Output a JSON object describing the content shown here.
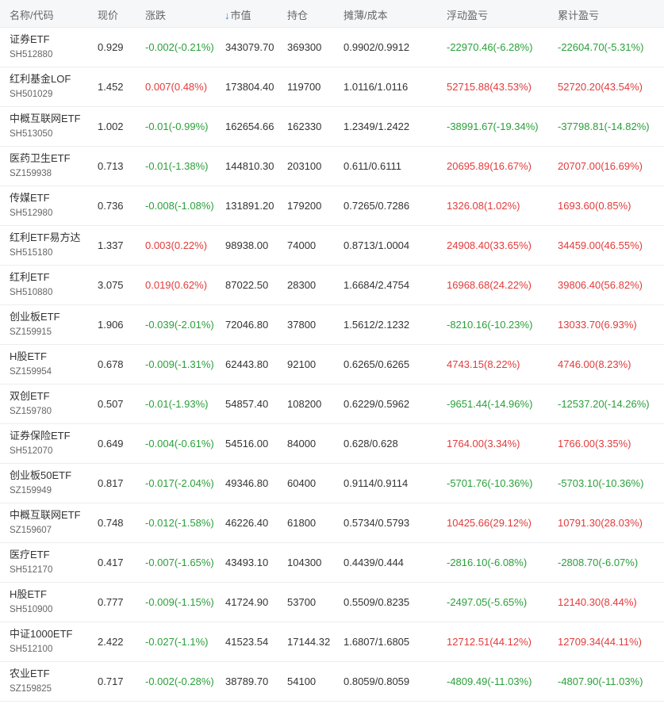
{
  "headers": {
    "name_code": "名称/代码",
    "price": "现价",
    "change": "涨跌",
    "market_value": "市值",
    "holdings": "持仓",
    "cost": "摊薄/成本",
    "floating_pl": "浮动盈亏",
    "total_pl": "累计盈亏",
    "sort_arrow": "↓"
  },
  "colors": {
    "up": "#e23b3b",
    "down": "#2a9f3a",
    "sort_active": "#3b7de0"
  },
  "rows": [
    {
      "name": "证券ETF",
      "code": "SH512880",
      "price": "0.929",
      "change": "-0.002(-0.21%)",
      "change_dir": "down",
      "market_value": "343079.70",
      "holdings": "369300",
      "cost": "0.9902/0.9912",
      "floating_pl": "-22970.46(-6.28%)",
      "floating_dir": "down",
      "total_pl": "-22604.70(-5.31%)",
      "total_dir": "down"
    },
    {
      "name": "红利基金LOF",
      "code": "SH501029",
      "price": "1.452",
      "change": "0.007(0.48%)",
      "change_dir": "up",
      "market_value": "173804.40",
      "holdings": "119700",
      "cost": "1.0116/1.0116",
      "floating_pl": "52715.88(43.53%)",
      "floating_dir": "up",
      "total_pl": "52720.20(43.54%)",
      "total_dir": "up"
    },
    {
      "name": "中概互联网ETF",
      "code": "SH513050",
      "price": "1.002",
      "change": "-0.01(-0.99%)",
      "change_dir": "down",
      "market_value": "162654.66",
      "holdings": "162330",
      "cost": "1.2349/1.2422",
      "floating_pl": "-38991.67(-19.34%)",
      "floating_dir": "down",
      "total_pl": "-37798.81(-14.82%)",
      "total_dir": "down"
    },
    {
      "name": "医药卫生ETF",
      "code": "SZ159938",
      "price": "0.713",
      "change": "-0.01(-1.38%)",
      "change_dir": "down",
      "market_value": "144810.30",
      "holdings": "203100",
      "cost": "0.611/0.6111",
      "floating_pl": "20695.89(16.67%)",
      "floating_dir": "up",
      "total_pl": "20707.00(16.69%)",
      "total_dir": "up"
    },
    {
      "name": "传媒ETF",
      "code": "SH512980",
      "price": "0.736",
      "change": "-0.008(-1.08%)",
      "change_dir": "down",
      "market_value": "131891.20",
      "holdings": "179200",
      "cost": "0.7265/0.7286",
      "floating_pl": "1326.08(1.02%)",
      "floating_dir": "up",
      "total_pl": "1693.60(0.85%)",
      "total_dir": "up"
    },
    {
      "name": "红利ETF易方达",
      "code": "SH515180",
      "price": "1.337",
      "change": "0.003(0.22%)",
      "change_dir": "up",
      "market_value": "98938.00",
      "holdings": "74000",
      "cost": "0.8713/1.0004",
      "floating_pl": "24908.40(33.65%)",
      "floating_dir": "up",
      "total_pl": "34459.00(46.55%)",
      "total_dir": "up"
    },
    {
      "name": "红利ETF",
      "code": "SH510880",
      "price": "3.075",
      "change": "0.019(0.62%)",
      "change_dir": "up",
      "market_value": "87022.50",
      "holdings": "28300",
      "cost": "1.6684/2.4754",
      "floating_pl": "16968.68(24.22%)",
      "floating_dir": "up",
      "total_pl": "39806.40(56.82%)",
      "total_dir": "up"
    },
    {
      "name": "创业板ETF",
      "code": "SZ159915",
      "price": "1.906",
      "change": "-0.039(-2.01%)",
      "change_dir": "down",
      "market_value": "72046.80",
      "holdings": "37800",
      "cost": "1.5612/2.1232",
      "floating_pl": "-8210.16(-10.23%)",
      "floating_dir": "down",
      "total_pl": "13033.70(6.93%)",
      "total_dir": "up"
    },
    {
      "name": "H股ETF",
      "code": "SZ159954",
      "price": "0.678",
      "change": "-0.009(-1.31%)",
      "change_dir": "down",
      "market_value": "62443.80",
      "holdings": "92100",
      "cost": "0.6265/0.6265",
      "floating_pl": "4743.15(8.22%)",
      "floating_dir": "up",
      "total_pl": "4746.00(8.23%)",
      "total_dir": "up"
    },
    {
      "name": "双创ETF",
      "code": "SZ159780",
      "price": "0.507",
      "change": "-0.01(-1.93%)",
      "change_dir": "down",
      "market_value": "54857.40",
      "holdings": "108200",
      "cost": "0.6229/0.5962",
      "floating_pl": "-9651.44(-14.96%)",
      "floating_dir": "down",
      "total_pl": "-12537.20(-14.26%)",
      "total_dir": "down"
    },
    {
      "name": "证券保险ETF",
      "code": "SH512070",
      "price": "0.649",
      "change": "-0.004(-0.61%)",
      "change_dir": "down",
      "market_value": "54516.00",
      "holdings": "84000",
      "cost": "0.628/0.628",
      "floating_pl": "1764.00(3.34%)",
      "floating_dir": "up",
      "total_pl": "1766.00(3.35%)",
      "total_dir": "up"
    },
    {
      "name": "创业板50ETF",
      "code": "SZ159949",
      "price": "0.817",
      "change": "-0.017(-2.04%)",
      "change_dir": "down",
      "market_value": "49346.80",
      "holdings": "60400",
      "cost": "0.9114/0.9114",
      "floating_pl": "-5701.76(-10.36%)",
      "floating_dir": "down",
      "total_pl": "-5703.10(-10.36%)",
      "total_dir": "down"
    },
    {
      "name": "中概互联网ETF",
      "code": "SZ159607",
      "price": "0.748",
      "change": "-0.012(-1.58%)",
      "change_dir": "down",
      "market_value": "46226.40",
      "holdings": "61800",
      "cost": "0.5734/0.5793",
      "floating_pl": "10425.66(29.12%)",
      "floating_dir": "up",
      "total_pl": "10791.30(28.03%)",
      "total_dir": "up"
    },
    {
      "name": "医疗ETF",
      "code": "SH512170",
      "price": "0.417",
      "change": "-0.007(-1.65%)",
      "change_dir": "down",
      "market_value": "43493.10",
      "holdings": "104300",
      "cost": "0.4439/0.444",
      "floating_pl": "-2816.10(-6.08%)",
      "floating_dir": "down",
      "total_pl": "-2808.70(-6.07%)",
      "total_dir": "down"
    },
    {
      "name": "H股ETF",
      "code": "SH510900",
      "price": "0.777",
      "change": "-0.009(-1.15%)",
      "change_dir": "down",
      "market_value": "41724.90",
      "holdings": "53700",
      "cost": "0.5509/0.8235",
      "floating_pl": "-2497.05(-5.65%)",
      "floating_dir": "down",
      "total_pl": "12140.30(8.44%)",
      "total_dir": "up"
    },
    {
      "name": "中证1000ETF",
      "code": "SH512100",
      "price": "2.422",
      "change": "-0.027(-1.1%)",
      "change_dir": "down",
      "market_value": "41523.54",
      "holdings": "17144.32",
      "cost": "1.6807/1.6805",
      "floating_pl": "12712.51(44.12%)",
      "floating_dir": "up",
      "total_pl": "12709.34(44.11%)",
      "total_dir": "up"
    },
    {
      "name": "农业ETF",
      "code": "SZ159825",
      "price": "0.717",
      "change": "-0.002(-0.28%)",
      "change_dir": "down",
      "market_value": "38789.70",
      "holdings": "54100",
      "cost": "0.8059/0.8059",
      "floating_pl": "-4809.49(-11.03%)",
      "floating_dir": "down",
      "total_pl": "-4807.90(-11.03%)",
      "total_dir": "down"
    }
  ]
}
